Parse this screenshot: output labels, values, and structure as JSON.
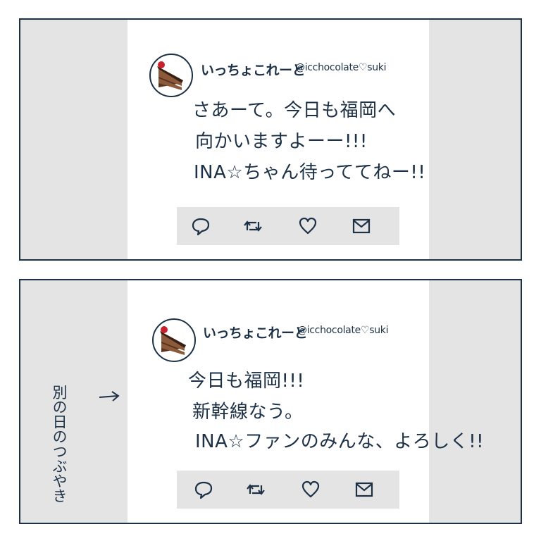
{
  "colors": {
    "ink": "#1d3146",
    "panel_gray": "#e4e4e4",
    "card_white": "#ffffff"
  },
  "panels": [
    {
      "user": {
        "display_name": "いっちょこれーと",
        "handle": "@icchocolate♡suki",
        "avatar_icon": "cake-icon"
      },
      "tweet_lines": [
        "さあーて。今日も福岡へ",
        "向かいますよーー!!!",
        "INA☆ちゃん待っててねー!!"
      ],
      "actions": [
        "reply-icon",
        "retweet-icon",
        "heart-icon",
        "mail-icon"
      ]
    },
    {
      "user": {
        "display_name": "いっちょこれーと",
        "handle": "@icchocolate♡suki",
        "avatar_icon": "cake-icon"
      },
      "tweet_lines": [
        "今日も福岡!!!",
        "新幹線なう。",
        "INA☆ファンのみんな、よろしく!!"
      ],
      "actions": [
        "reply-icon",
        "retweet-icon",
        "heart-icon",
        "mail-icon"
      ],
      "side_note": "別の日のつぶやき"
    }
  ]
}
